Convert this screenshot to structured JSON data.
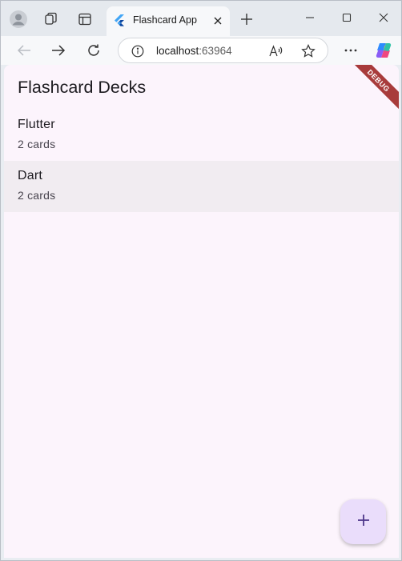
{
  "browser": {
    "tab": {
      "title": "Flashcard App",
      "favicon": "flutter-logo-icon",
      "close_icon": "close-icon"
    },
    "toolbar_icons": [
      "profile-icon",
      "workspaces-icon",
      "tab-actions-icon",
      "new-tab-icon"
    ],
    "window_controls": [
      "minimize-icon",
      "maximize-icon",
      "close-icon"
    ],
    "nav": [
      "back-icon",
      "forward-icon",
      "refresh-icon"
    ],
    "address": {
      "host": "localhost",
      "port": ":63964",
      "site_info_icon": "info-icon"
    },
    "right_icons": [
      "read-aloud-icon",
      "favorite-star-icon",
      "more-icon",
      "copilot-icon"
    ]
  },
  "app": {
    "title": "Flashcard Decks",
    "debug_banner": "DEBUG",
    "decks": [
      {
        "name": "Flutter",
        "count": "2 cards",
        "selected": false
      },
      {
        "name": "Dart",
        "count": "2 cards",
        "selected": true
      }
    ],
    "fab_icon": "add-icon",
    "colors": {
      "background": "#fcf4fc",
      "selected_row": "#f1ecf1",
      "fab": "#eaddfb",
      "fab_icon": "#4f378b",
      "debug_ribbon": "#a83b3b"
    }
  }
}
